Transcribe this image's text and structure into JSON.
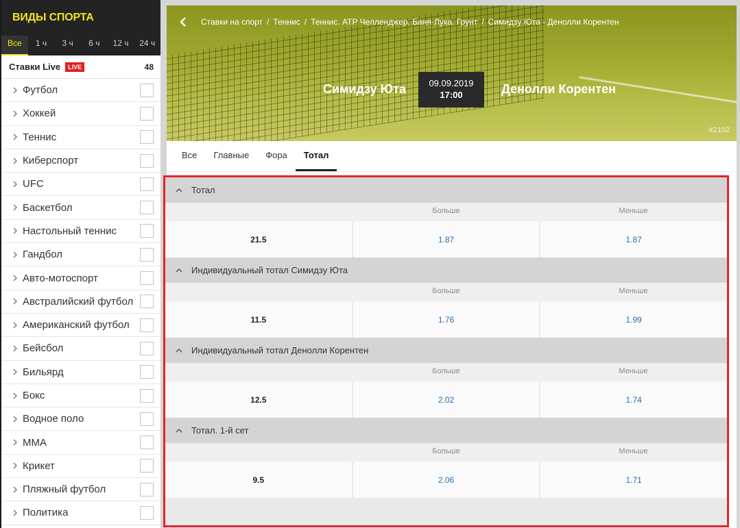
{
  "sidebar": {
    "title": "ВИДЫ СПОРТА",
    "time_filters": [
      "Все",
      "1 ч",
      "3 ч",
      "6 ч",
      "12 ч",
      "24 ч"
    ],
    "live": {
      "label": "Ставки Live",
      "badge": "LIVE",
      "count": "48"
    },
    "sports": [
      "Футбол",
      "Хоккей",
      "Теннис",
      "Киберспорт",
      "UFC",
      "Баскетбол",
      "Настольный теннис",
      "Гандбол",
      "Авто-мотоспорт",
      "Австралийский футбол",
      "Американский футбол",
      "Бейсбол",
      "Бильярд",
      "Бокс",
      "Водное поло",
      "MMA",
      "Крикет",
      "Пляжный футбол",
      "Политика"
    ]
  },
  "header": {
    "breadcrumbs": [
      "Ставки на спорт",
      "Теннис",
      "Теннис. ATP Челленджер. Баня-Лука. Грунт",
      "Симидзу Юта - Денолли Корентен"
    ],
    "home_team": "Симидзу Юта",
    "away_team": "Денолли Корентен",
    "date": "09.09.2019",
    "time": "17:00",
    "event_id": "#2102"
  },
  "tabs": [
    "Все",
    "Главные",
    "Фора",
    "Тотал"
  ],
  "active_tab": "Тотал",
  "markets": [
    {
      "title": "Тотал",
      "over_label": "Больше",
      "under_label": "Меньше",
      "line": "21.5",
      "over": "1.87",
      "under": "1.87"
    },
    {
      "title": "Индивидуальный тотал Симидзу Юта",
      "over_label": "Больше",
      "under_label": "Меньше",
      "line": "11.5",
      "over": "1.76",
      "under": "1.99"
    },
    {
      "title": "Индивидуальный тотал Денолли Корентен",
      "over_label": "Больше",
      "under_label": "Меньше",
      "line": "12.5",
      "over": "2.02",
      "under": "1.74"
    },
    {
      "title": "Тотал. 1-й сет",
      "over_label": "Больше",
      "under_label": "Меньше",
      "line": "9.5",
      "over": "2.06",
      "under": "1.71"
    }
  ],
  "colors": {
    "accent": "#f2e31d",
    "highlight_border": "#e2252b",
    "odds_text": "#2b6cb0",
    "live_badge": "#e02020"
  }
}
